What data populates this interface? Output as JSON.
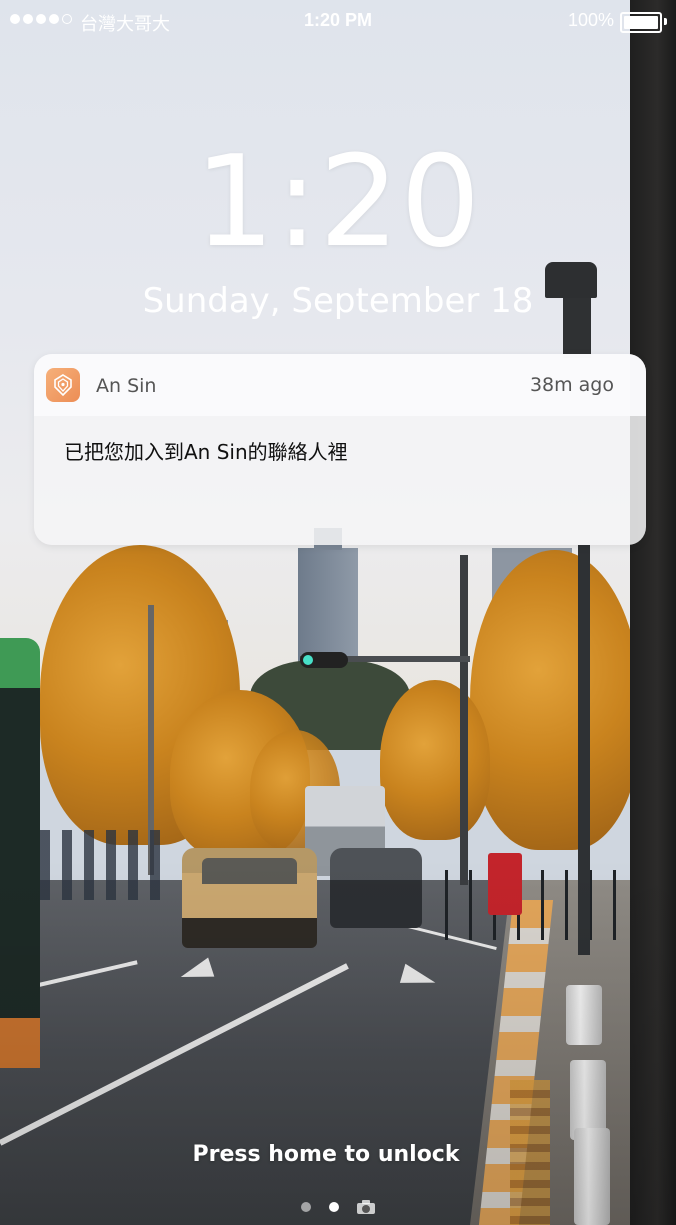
{
  "status_bar": {
    "signal_dots_filled": 4,
    "signal_dots_total": 5,
    "carrier": "台灣大哥大",
    "time": "1:20 PM",
    "battery_percent_label": "100%",
    "battery_level": 1.0
  },
  "lock_screen": {
    "clock": "1:20",
    "date": "Sunday, September 18"
  },
  "notification": {
    "app_name": "An Sin",
    "app_icon": "an-sin-app-icon",
    "age": "38m ago",
    "message": "已把您加入到An Sin的聯絡人裡",
    "accent_color": "#ee9a62"
  },
  "bottom": {
    "unlock_hint": "Press home to unlock",
    "pages": [
      "dot",
      "dot",
      "camera"
    ],
    "active_page": 1
  }
}
